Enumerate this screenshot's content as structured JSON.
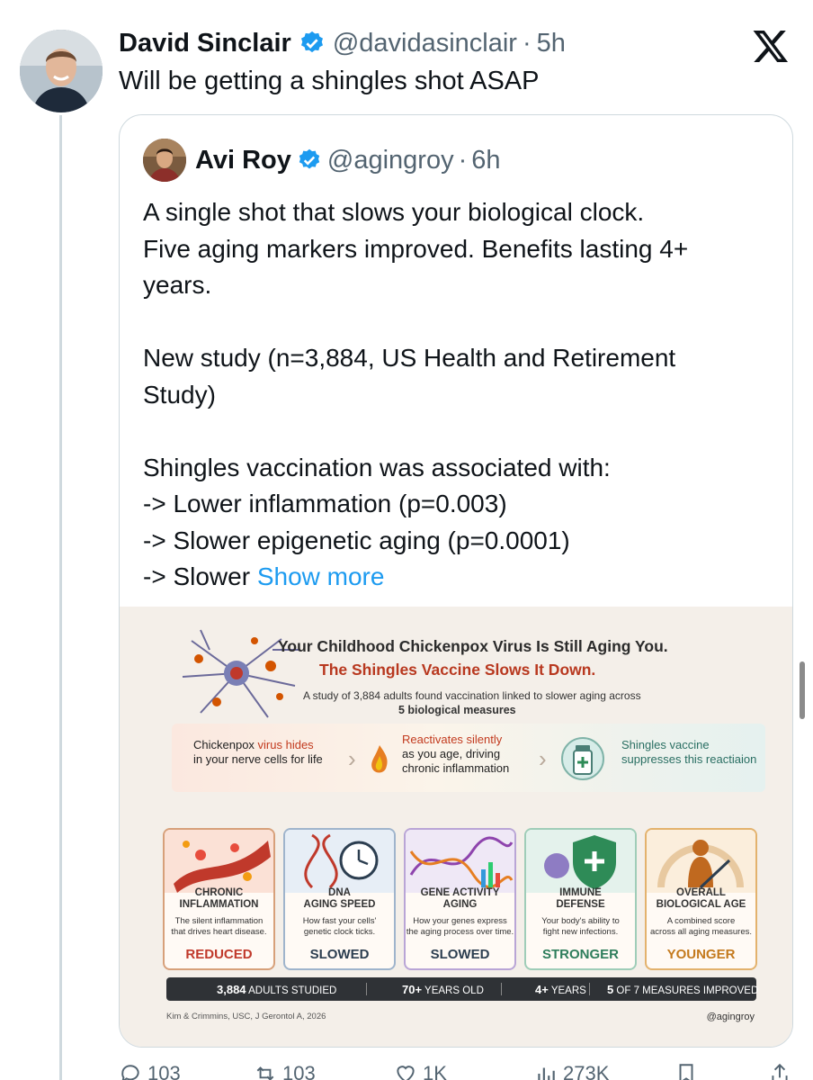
{
  "main_tweet": {
    "name": "David Sinclair",
    "handle": "@davidasinclair",
    "separator": "·",
    "time": "5h",
    "text": "Will be getting a shingles shot ASAP"
  },
  "quote_tweet": {
    "name": "Avi Roy",
    "handle": "@agingroy",
    "separator": "·",
    "time": "6h",
    "text": "A single shot that slows your biological clock.\nFive aging markers improved. Benefits lasting 4+\nyears.\n\nNew study (n=3,884, US Health and Retirement\nStudy)\n\nShingles vaccination was associated with:\n-> Lower inflammation (p=0.003)\n-> Slower epigenetic aging (p=0.0001)\n-> Slower ",
    "show_more": "Show more"
  },
  "infographic": {
    "title_line1": "Your Childhood Chickenpox Virus Is Still Aging You.",
    "title_line2": "The Shingles Vaccine Slows It Down.",
    "subtitle_line1": "A study of 3,884 adults found vaccination linked to slower aging across",
    "subtitle_line2": "5 biological measures",
    "flow": {
      "step1_a": "Chickenpox ",
      "step1_b": "virus hides",
      "step1_c": "in your nerve cells for life",
      "step2_a": "Reactivates silently",
      "step2_b": "as you age, driving\nchronic inflammation",
      "step3_a": "Shingles vaccine",
      "step3_b": "suppresses this reactiaion"
    },
    "cards": [
      {
        "title": "CHRONIC\nINFLAMMATION",
        "desc": "The silent inflammation\nthat drives heart disease.",
        "result": "REDUCED",
        "color": "#c0392b"
      },
      {
        "title": "DNA\nAGING SPEED",
        "desc": "How fast your cells'\ngenetic clock ticks.",
        "result": "SLOWED",
        "color": "#2c3e50"
      },
      {
        "title": "GENE ACTIVITY\nAGING",
        "desc": "How your genes express\nthe aging process over time.",
        "result": "SLOWED",
        "color": "#2c3e50"
      },
      {
        "title": "IMMUNE\nDEFENSE",
        "desc": "Your body's ability to\nfight new infections.",
        "result": "STRONGER",
        "color": "#2e7d5b"
      },
      {
        "title": "OVERALL\nBIOLOGICAL AGE",
        "desc": "A combined score\nacross all aging measures.",
        "result": "YOUNGER",
        "color": "#c47a1e"
      }
    ],
    "stats": [
      {
        "value": "3,884",
        "label": " ADULTS STUDIED"
      },
      {
        "value": "70+",
        "label": " YEARS OLD"
      },
      {
        "value": "4+",
        "label": " YEARS"
      },
      {
        "value": "5",
        "label": " OF 7 MEASURES IMPROVED"
      }
    ],
    "citation": "Kim & Crimmins, USC, J Gerontol A, 2026",
    "credit": "@agingroy"
  },
  "actions": {
    "replies": "103",
    "reposts": "103",
    "likes": "1K",
    "views": "273K"
  },
  "colors": {
    "accent": "#1d9bf0",
    "verified": "#1d9bf0",
    "muted": "#536471"
  }
}
